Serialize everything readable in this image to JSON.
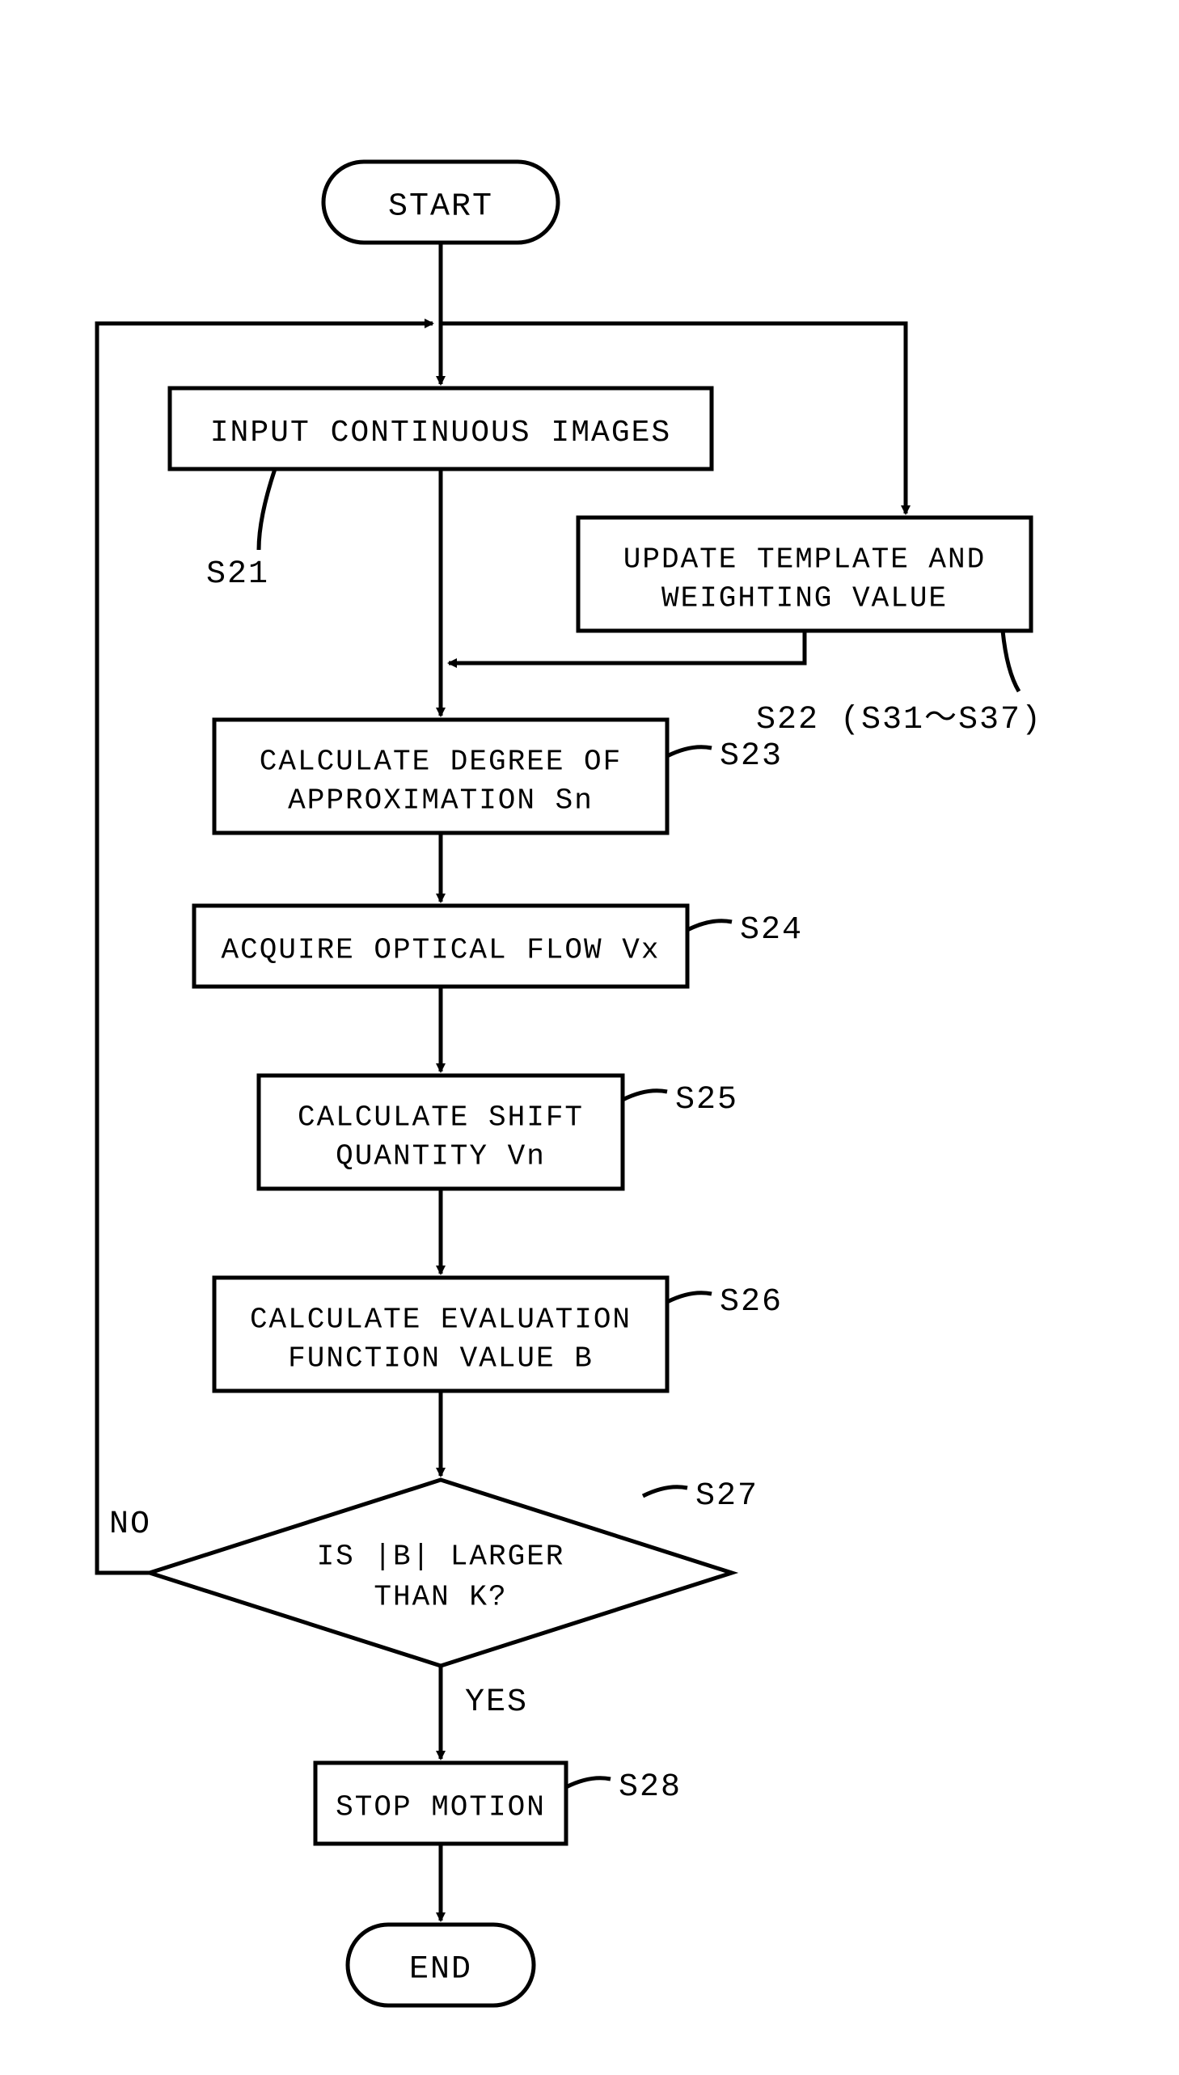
{
  "nodes": {
    "start": {
      "text": "START"
    },
    "input": {
      "text": "INPUT CONTINUOUS IMAGES",
      "label": "S21"
    },
    "update": {
      "line1": "UPDATE TEMPLATE AND",
      "line2": "WEIGHTING VALUE",
      "label": "S22 (S31～S37)"
    },
    "calcDeg": {
      "line1": "CALCULATE DEGREE OF",
      "line2": "APPROXIMATION Sn",
      "label": "S23"
    },
    "acquire": {
      "text": "ACQUIRE OPTICAL FLOW Vx",
      "label": "S24"
    },
    "calcShift": {
      "line1": "CALCULATE SHIFT",
      "line2": "QUANTITY Vn",
      "label": "S25"
    },
    "calcEval": {
      "line1": "CALCULATE EVALUATION",
      "line2": "FUNCTION VALUE B",
      "label": "S26"
    },
    "decision": {
      "line1": "IS |B| LARGER",
      "line2": "THAN K?",
      "label": "S27"
    },
    "stop": {
      "text": "STOP MOTION",
      "label": "S28"
    },
    "end": {
      "text": "END"
    }
  },
  "edges": {
    "no": "NO",
    "yes": "YES"
  }
}
